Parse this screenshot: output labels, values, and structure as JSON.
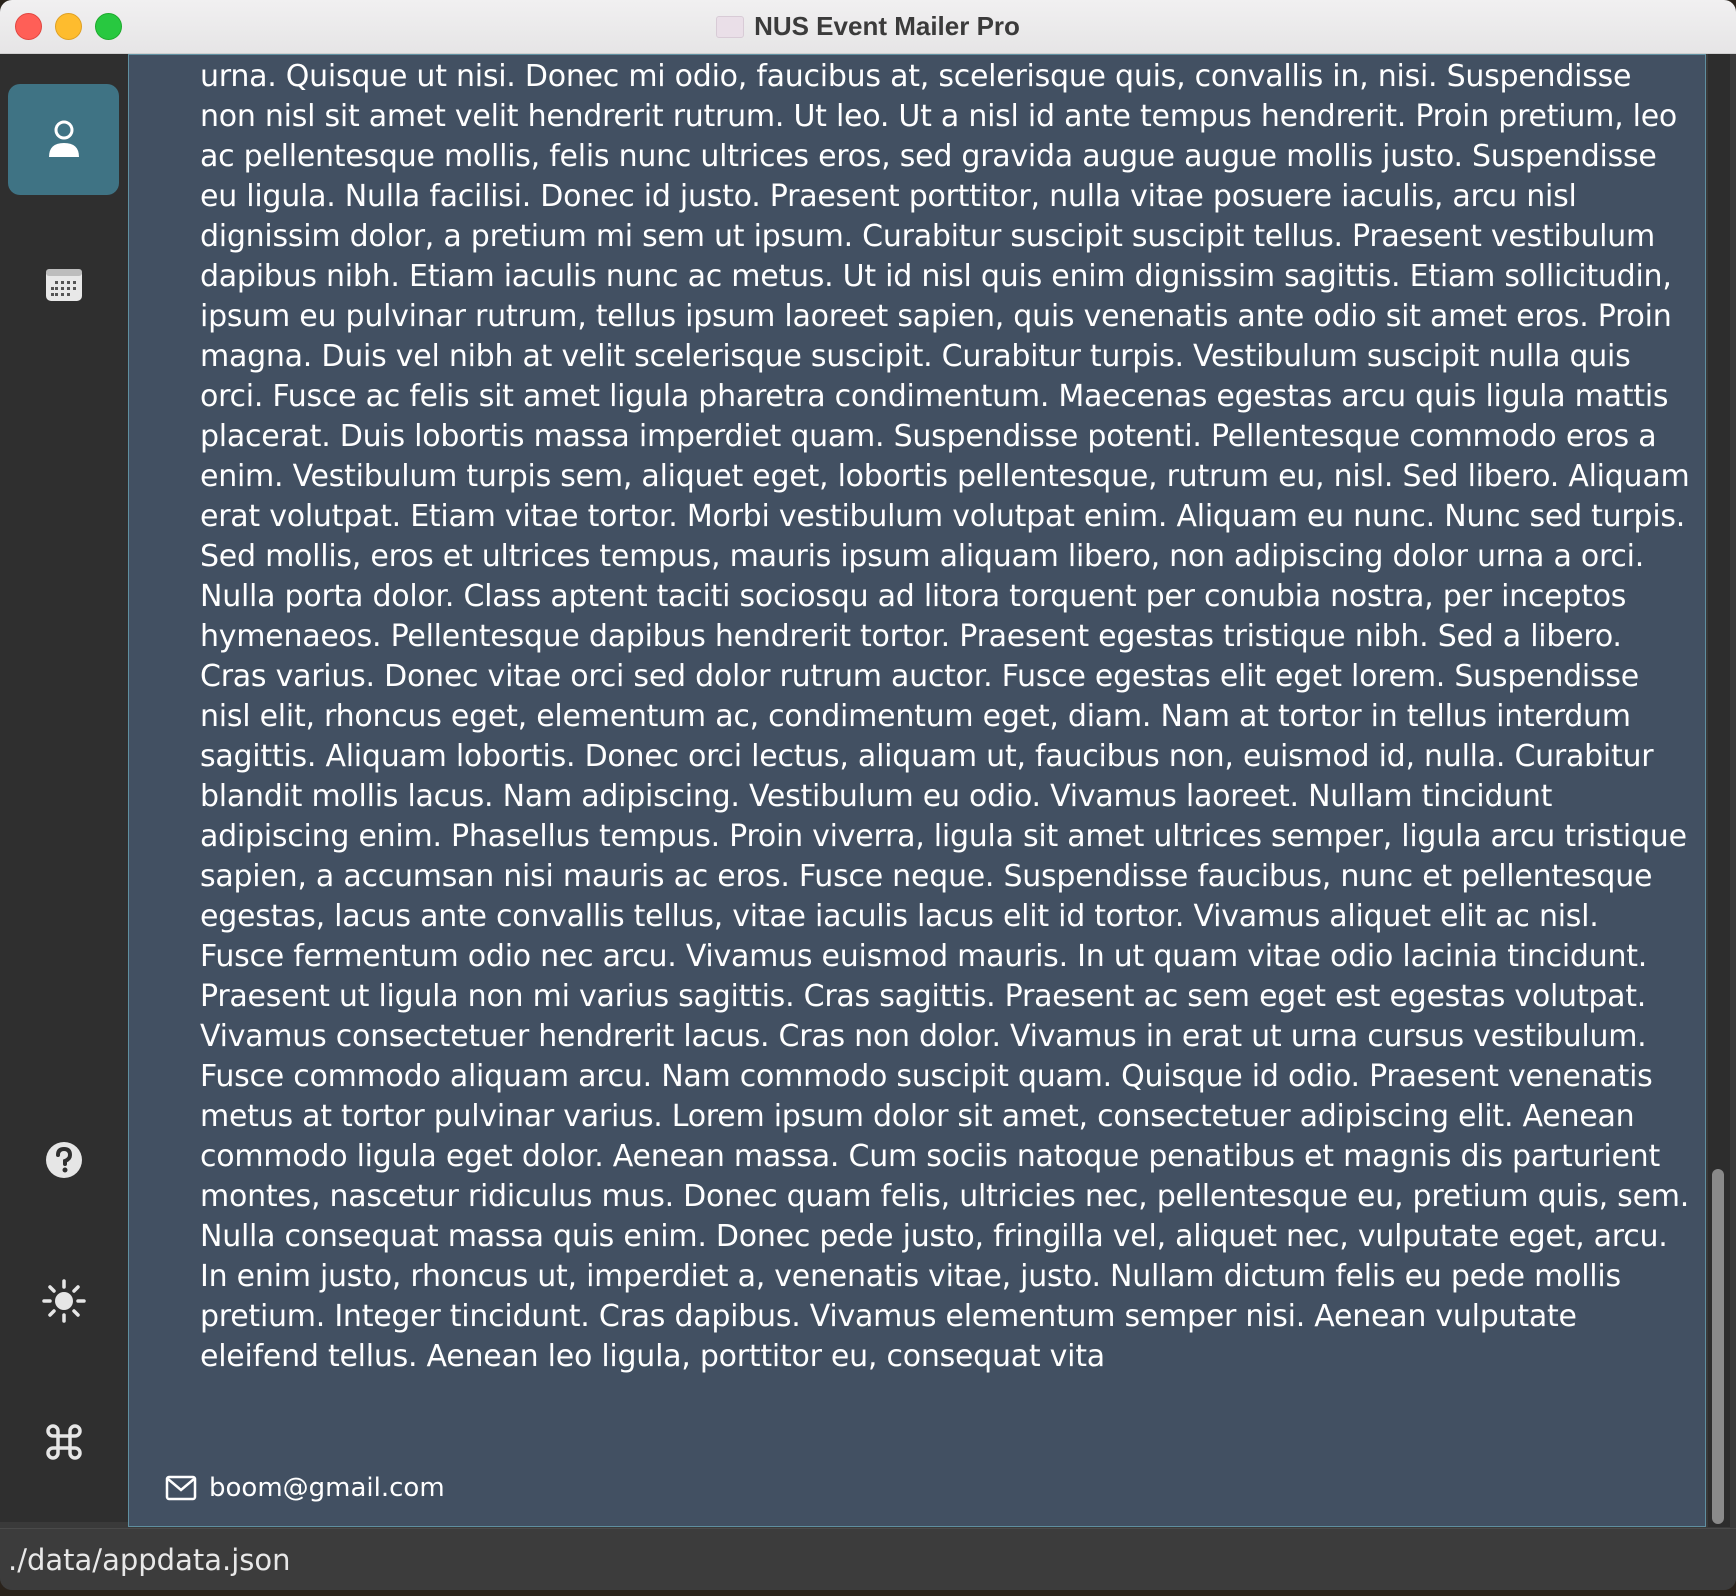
{
  "window": {
    "title": "NUS Event Mailer Pro"
  },
  "sidebar": {
    "items": [
      {
        "name": "person-icon",
        "active": true
      },
      {
        "name": "calendar-icon",
        "active": false
      },
      {
        "name": "help-icon",
        "active": false
      },
      {
        "name": "sun-icon",
        "active": false
      },
      {
        "name": "command-icon",
        "active": false
      }
    ]
  },
  "detail": {
    "text": "urna. Quisque ut nisi. Donec mi odio, faucibus at, scelerisque quis, convallis in, nisi. Suspendisse non nisl sit amet velit hendrerit rutrum. Ut leo. Ut a nisl id ante tempus hendrerit. Proin pretium, leo ac pellentesque mollis, felis nunc ultrices eros, sed gravida augue augue mollis justo. Suspendisse eu ligula. Nulla facilisi. Donec id justo. Praesent porttitor, nulla vitae posuere iaculis, arcu nisl dignissim dolor, a pretium mi sem ut ipsum. Curabitur suscipit suscipit tellus. Praesent vestibulum dapibus nibh. Etiam iaculis nunc ac metus. Ut id nisl quis enim dignissim sagittis. Etiam sollicitudin, ipsum eu pulvinar rutrum, tellus ipsum laoreet sapien, quis venenatis ante odio sit amet eros. Proin magna. Duis vel nibh at velit scelerisque suscipit. Curabitur turpis. Vestibulum suscipit nulla quis orci. Fusce ac felis sit amet ligula pharetra condimentum. Maecenas egestas arcu quis ligula mattis placerat. Duis lobortis massa imperdiet quam. Suspendisse potenti. Pellentesque commodo eros a enim. Vestibulum turpis sem, aliquet eget, lobortis pellentesque, rutrum eu, nisl. Sed libero. Aliquam erat volutpat. Etiam vitae tortor. Morbi vestibulum volutpat enim. Aliquam eu nunc. Nunc sed turpis. Sed mollis, eros et ultrices tempus, mauris ipsum aliquam libero, non adipiscing dolor urna a orci. Nulla porta dolor. Class aptent taciti sociosqu ad litora torquent per conubia nostra, per inceptos hymenaeos. Pellentesque dapibus hendrerit tortor. Praesent egestas tristique nibh. Sed a libero. Cras varius. Donec vitae orci sed dolor rutrum auctor. Fusce egestas elit eget lorem. Suspendisse nisl elit, rhoncus eget, elementum ac, condimentum eget, diam. Nam at tortor in tellus interdum sagittis. Aliquam lobortis. Donec orci lectus, aliquam ut, faucibus non, euismod id, nulla. Curabitur blandit mollis lacus. Nam adipiscing. Vestibulum eu odio. Vivamus laoreet. Nullam tincidunt adipiscing enim. Phasellus tempus. Proin viverra, ligula sit amet ultrices semper, ligula arcu tristique sapien, a accumsan nisi mauris ac eros. Fusce neque. Suspendisse faucibus, nunc et pellentesque egestas, lacus ante convallis tellus, vitae iaculis lacus elit id tortor. Vivamus aliquet elit ac nisl. Fusce fermentum odio nec arcu. Vivamus euismod mauris. In ut quam vitae odio lacinia tincidunt. Praesent ut ligula non mi varius sagittis. Cras sagittis. Praesent ac sem eget est egestas volutpat. Vivamus consectetuer hendrerit lacus. Cras non dolor. Vivamus in erat ut urna cursus vestibulum. Fusce commodo aliquam arcu. Nam commodo suscipit quam. Quisque id odio. Praesent venenatis metus at tortor pulvinar varius. Lorem ipsum dolor sit amet, consectetuer adipiscing elit. Aenean commodo ligula eget dolor. Aenean massa. Cum sociis natoque penatibus et magnis dis parturient montes, nascetur ridiculus mus. Donec quam felis, ultricies nec, pellentesque eu, pretium quis, sem. Nulla consequat massa quis enim. Donec pede justo, fringilla vel, aliquet nec, vulputate eget, arcu. In enim justo, rhoncus ut, imperdiet a, venenatis vitae, justo. Nullam dictum felis eu pede mollis pretium. Integer tincidunt. Cras dapibus. Vivamus elementum semper nisi. Aenean vulputate eleifend tellus. Aenean leo ligula, porttitor eu, consequat vita",
    "email": "boom@gmail.com"
  },
  "status": {
    "path": "./data/appdata.json"
  },
  "colors": {
    "accent": "#3f7384",
    "content_bg": "#425062",
    "sidebar_bg": "#2f2f2f"
  }
}
